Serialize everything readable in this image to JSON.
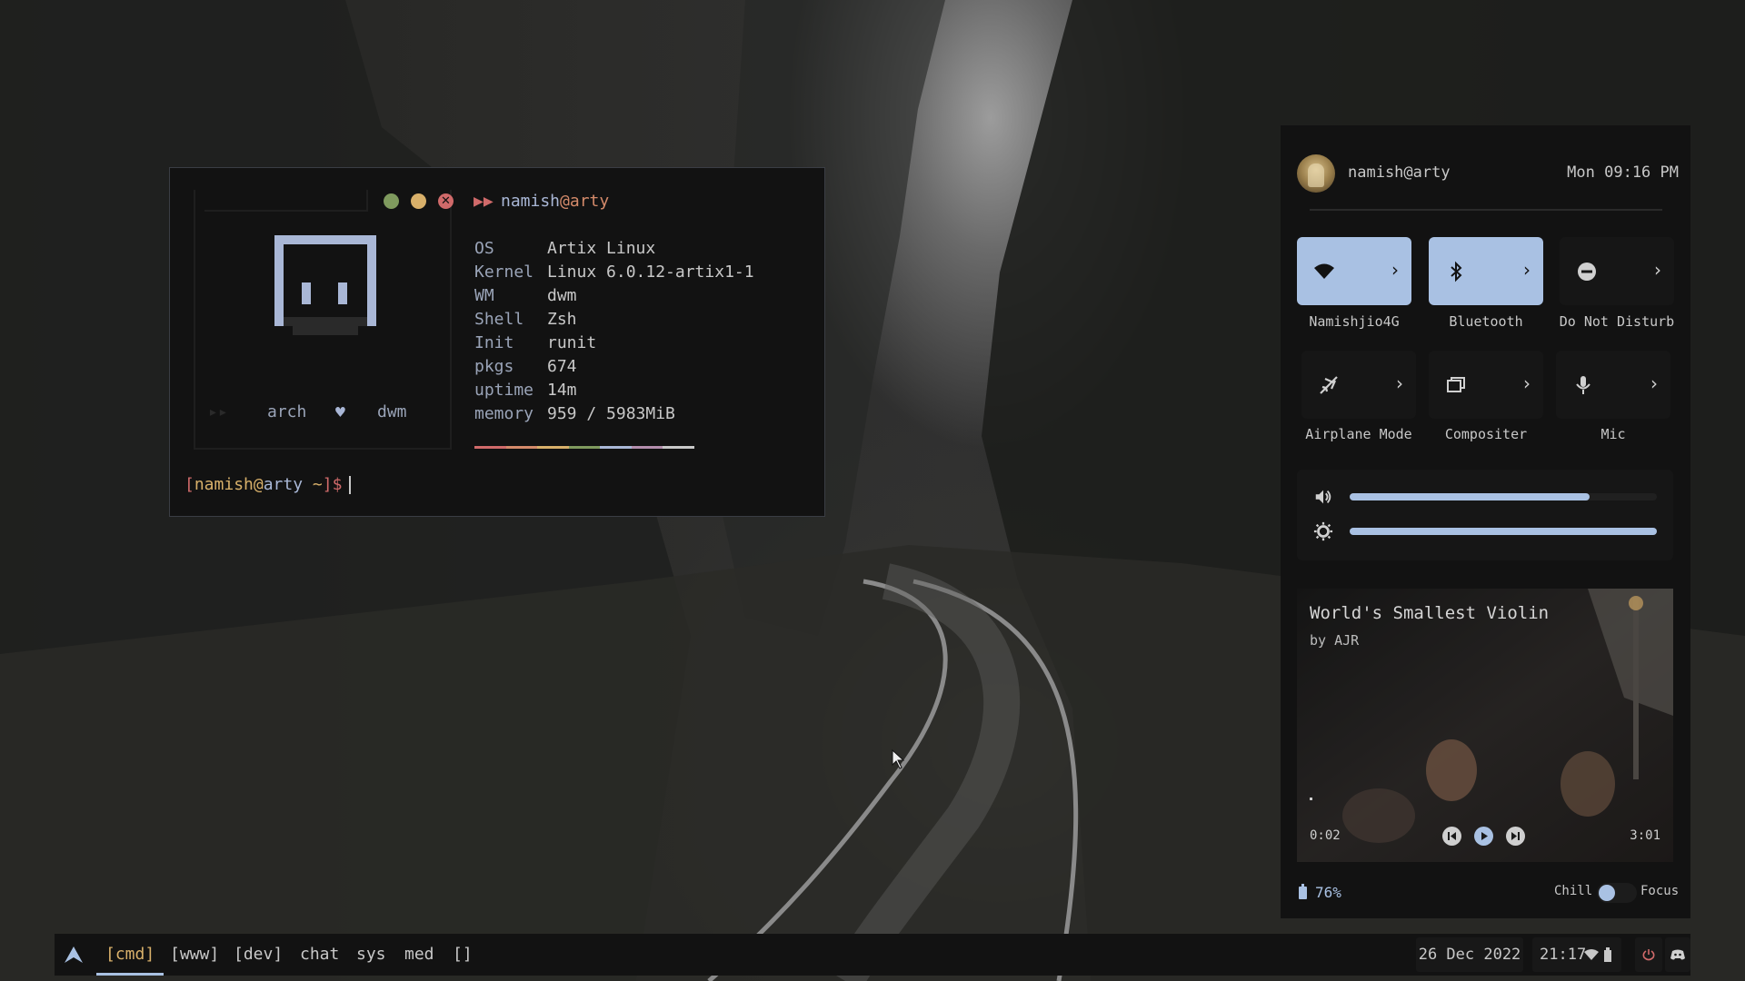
{
  "terminal": {
    "header_user": "namish",
    "header_at": "@",
    "header_host": "arty",
    "art_word_left": "arch",
    "art_word_right": "dwm",
    "info": [
      {
        "key": "OS",
        "value": "Artix Linux"
      },
      {
        "key": "Kernel",
        "value": "Linux 6.0.12-artix1-1"
      },
      {
        "key": "WM",
        "value": "dwm"
      },
      {
        "key": "Shell",
        "value": "Zsh"
      },
      {
        "key": "Init",
        "value": "runit"
      },
      {
        "key": "pkgs",
        "value": "674"
      },
      {
        "key": "uptime",
        "value": "14m"
      },
      {
        "key": "memory",
        "value": "959 / 5983MiB"
      }
    ],
    "prompt": {
      "open": "[",
      "user": "namish",
      "at": "@",
      "host": "arty",
      "path": " ~",
      "close": "]$"
    },
    "rainbow_colors": [
      "#d06a6a",
      "#d48a6a",
      "#d8b06a",
      "#7f9a5e",
      "#a9b7d6",
      "#b48ead",
      "#c8c8c8"
    ]
  },
  "control_center": {
    "user": "namish@arty",
    "datetime": "Mon 09:16 PM",
    "tiles": [
      {
        "label": "Namishjio4G",
        "state": "on",
        "icon": "wifi-icon"
      },
      {
        "label": "Bluetooth",
        "state": "on",
        "icon": "bluetooth-icon"
      },
      {
        "label": "Do Not Disturb",
        "state": "off",
        "icon": "minus-circle-icon"
      },
      {
        "label": "Airplane Mode",
        "state": "off",
        "icon": "airplane-icon"
      },
      {
        "label": "Compositer",
        "state": "off",
        "icon": "windows-icon"
      },
      {
        "label": "Mic",
        "state": "off",
        "icon": "microphone-icon"
      }
    ],
    "volume_level": 0.78,
    "brightness_level": 1.0,
    "player": {
      "title": "World's Smallest Violin",
      "artist": "by AJR",
      "elapsed": "0:02",
      "duration": "3:01"
    },
    "battery": "76%",
    "mode_left": "Chill",
    "mode_right": "Focus"
  },
  "bar": {
    "workspaces": [
      "[cmd]",
      "[www]",
      "[dev]",
      "chat",
      "sys",
      "med",
      "[]"
    ],
    "date": "26 Dec 2022",
    "time": "21:17"
  },
  "colors": {
    "accent": "#a9c1e3",
    "red": "#d06a6a",
    "yellow": "#d8b06a",
    "green": "#7f9a5e",
    "panel": "#121212"
  }
}
